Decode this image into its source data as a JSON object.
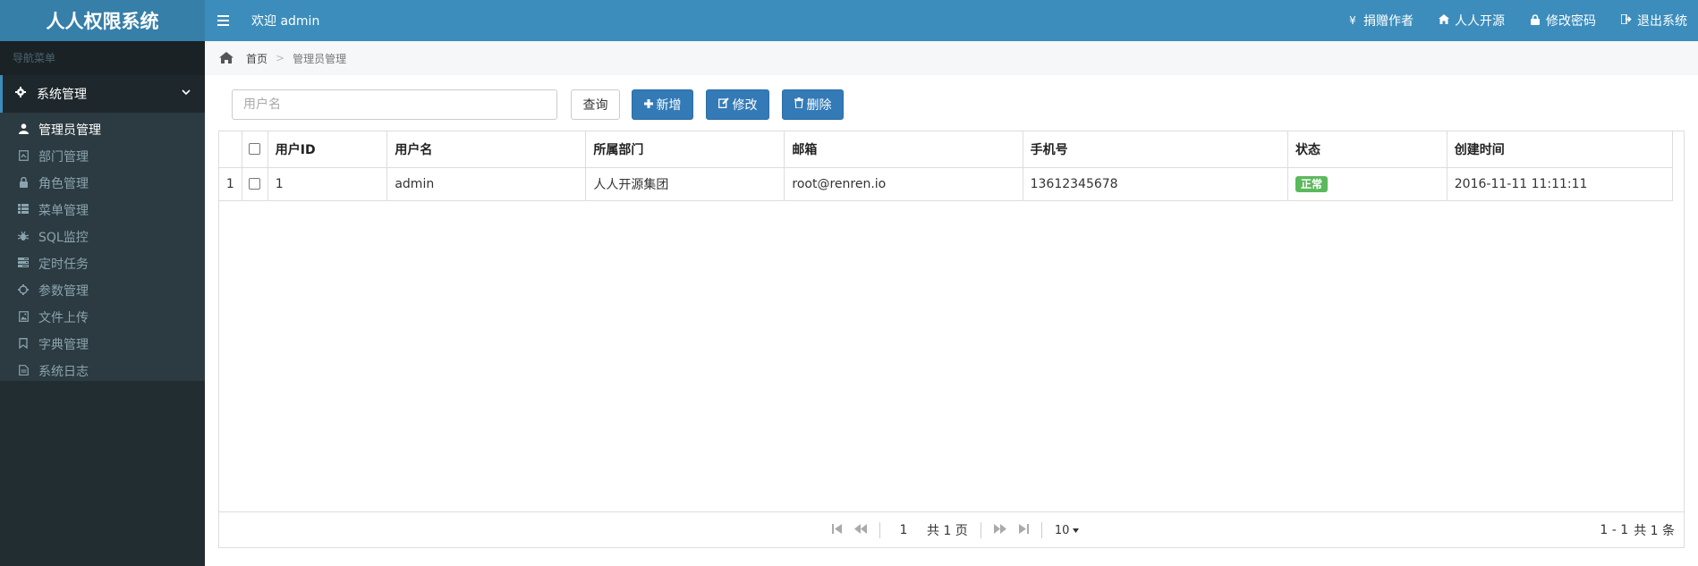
{
  "app": {
    "title": "人人权限系统",
    "welcome": "欢迎 admin"
  },
  "top_actions": [
    {
      "icon": "¥",
      "label": "捐赠作者"
    },
    {
      "icon": "⌂",
      "label": "人人开源"
    },
    {
      "icon": "🔒",
      "label": "修改密码"
    },
    {
      "icon": "⇥",
      "label": "退出系统"
    }
  ],
  "sidebar": {
    "header": "导航菜单",
    "group": {
      "label": "系统管理"
    },
    "items": [
      {
        "label": "管理员管理",
        "icon": "user-icon"
      },
      {
        "label": "部门管理",
        "icon": "department-icon"
      },
      {
        "label": "角色管理",
        "icon": "role-icon"
      },
      {
        "label": "菜单管理",
        "icon": "menu-list-icon"
      },
      {
        "label": "SQL监控",
        "icon": "bug-icon"
      },
      {
        "label": "定时任务",
        "icon": "tasks-icon"
      },
      {
        "label": "参数管理",
        "icon": "cog-icon"
      },
      {
        "label": "文件上传",
        "icon": "image-icon"
      },
      {
        "label": "字典管理",
        "icon": "bookmark-icon"
      },
      {
        "label": "系统日志",
        "icon": "file-icon"
      }
    ]
  },
  "breadcrumb": {
    "home": "首页",
    "current": "管理员管理"
  },
  "toolbar": {
    "search_placeholder": "用户名",
    "query_label": "查询",
    "add_label": "新增",
    "edit_label": "修改",
    "delete_label": "删除"
  },
  "table": {
    "columns": [
      "用户ID",
      "用户名",
      "所属部门",
      "邮箱",
      "手机号",
      "状态",
      "创建时间"
    ],
    "rows": [
      {
        "rownum": "1",
        "user_id": "1",
        "username": "admin",
        "dept": "人人开源集团",
        "email": "root@renren.io",
        "mobile": "13612345678",
        "status": "正常",
        "created": "2016-11-11 11:11:11"
      }
    ]
  },
  "pager": {
    "page": "1",
    "total_pages": "共 1 页",
    "page_size": "10",
    "range": "1 - 1",
    "total_records": "共 1 条"
  },
  "colors": {
    "header": "#3c8dbc",
    "logo": "#367fa9",
    "sidebar": "#222d32",
    "primary": "#337ab7",
    "success": "#5cb85c"
  }
}
